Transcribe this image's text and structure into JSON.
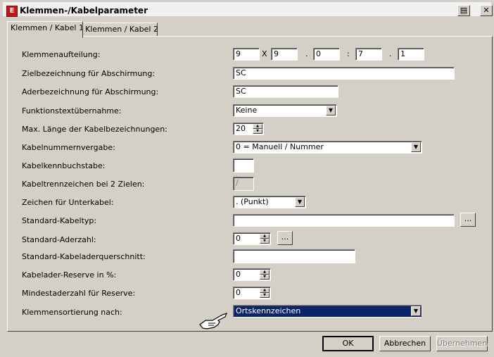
{
  "window": {
    "title": "Klemmen-/Kabelparameter",
    "icon": "app-logo-icon",
    "buttons": {
      "print": "▤",
      "close": "✕"
    }
  },
  "tabs": [
    {
      "label": "Klemmen / Kabel 1",
      "active": true
    },
    {
      "label": "Klemmen / Kabel 2",
      "active": false
    }
  ],
  "form": {
    "klemmenaufteilung": {
      "label": "Klemmenaufteilung:",
      "v1": "9",
      "sep1": "X",
      "v2": "9",
      "sep2": ".",
      "v3": "0",
      "sep3": ":",
      "v4": "7",
      "sep4": ".",
      "v5": "1"
    },
    "zielbezeichnung": {
      "label": "Zielbezeichnung für Abschirmung:",
      "value": "SC"
    },
    "aderbezeichnung": {
      "label": "Aderbezeichnung für Abschirmung:",
      "value": "SC"
    },
    "funktionstext": {
      "label": "Funktionstextübernahme:",
      "value": "Keine"
    },
    "max_laenge": {
      "label": "Max. Länge der Kabelbezeichnungen:",
      "value": "20"
    },
    "kabelnummernvergabe": {
      "label": "Kabelnummernvergabe:",
      "value": "0 = Manuell / Nummer"
    },
    "kabelkennbuchstabe": {
      "label": "Kabelkennbuchstabe:",
      "value": ""
    },
    "kabeltrennzeichen": {
      "label": "Kabeltrennzeichen bei 2 Zielen:",
      "value": "/"
    },
    "zeichen_unterkabel": {
      "label": "Zeichen für Unterkabel:",
      "value": ". (Punkt)"
    },
    "standard_kabeltyp": {
      "label": "Standard-Kabeltyp:",
      "value": "",
      "browse": "..."
    },
    "standard_aderzahl": {
      "label": "Standard-Aderzahl:",
      "value": "0",
      "browse": "..."
    },
    "standard_querschnitt": {
      "label": "Standard-Kabeladerquerschnitt:",
      "value": ""
    },
    "kabelader_reserve": {
      "label": "Kabelader-Reserve in %:",
      "value": "0"
    },
    "mindestaderzahl": {
      "label": "Mindestaderzahl für Reserve:",
      "value": "0"
    },
    "klemmensortierung": {
      "label": "Klemmensortierung nach:",
      "value": "Ortskennzeichen"
    }
  },
  "footer": {
    "ok": "OK",
    "cancel": "Abbrechen",
    "apply": "Übernehmen"
  },
  "colors": {
    "face": "#d4d0c8",
    "selection": "#0a246a",
    "icon_red": "#c81414"
  }
}
